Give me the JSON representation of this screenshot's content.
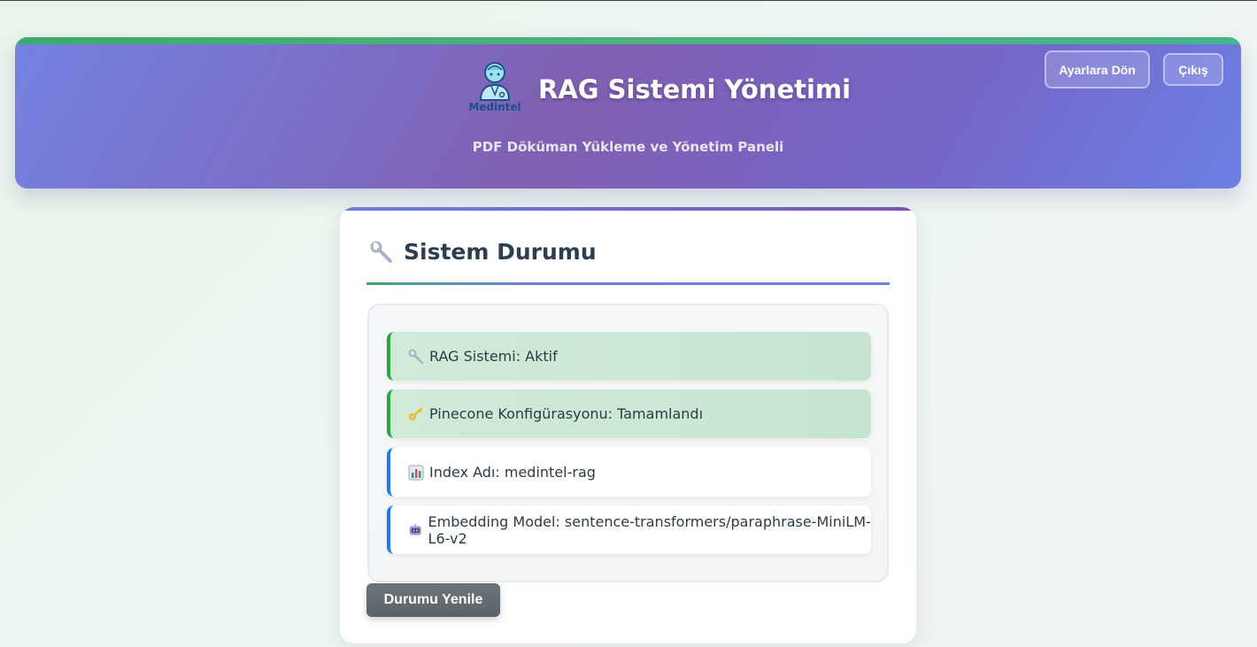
{
  "header": {
    "logo_text": "Medintel",
    "title": "RAG Sistemi Yönetimi",
    "subtitle": "PDF Döküman Yükleme ve Yönetim Paneli",
    "settings_button": "Ayarlara Dön",
    "logout_button": "Çıkış"
  },
  "status_card": {
    "title": "Sistem Durumu",
    "items": [
      {
        "text": "RAG Sistemi: Aktif",
        "icon": "wrench-icon",
        "status": "success"
      },
      {
        "text": "Pinecone Konfigürasyonu: Tamamlandı",
        "icon": "key-icon",
        "status": "success"
      },
      {
        "text": "Index Adı: medintel-rag",
        "icon": "bar-chart-icon",
        "status": "info"
      },
      {
        "text": "Embedding Model: sentence-transformers/paraphrase-MiniLM-L6-v2",
        "icon": "robot-icon",
        "status": "info"
      }
    ],
    "refresh_button": "Durumu Yenile"
  },
  "colors": {
    "header_gradient": [
      "#7482e2",
      "#8060b2",
      "#6c80e4"
    ],
    "success_border": "#28a745",
    "info_border": "#1e7be8",
    "refresh_button": "#5c6368"
  }
}
